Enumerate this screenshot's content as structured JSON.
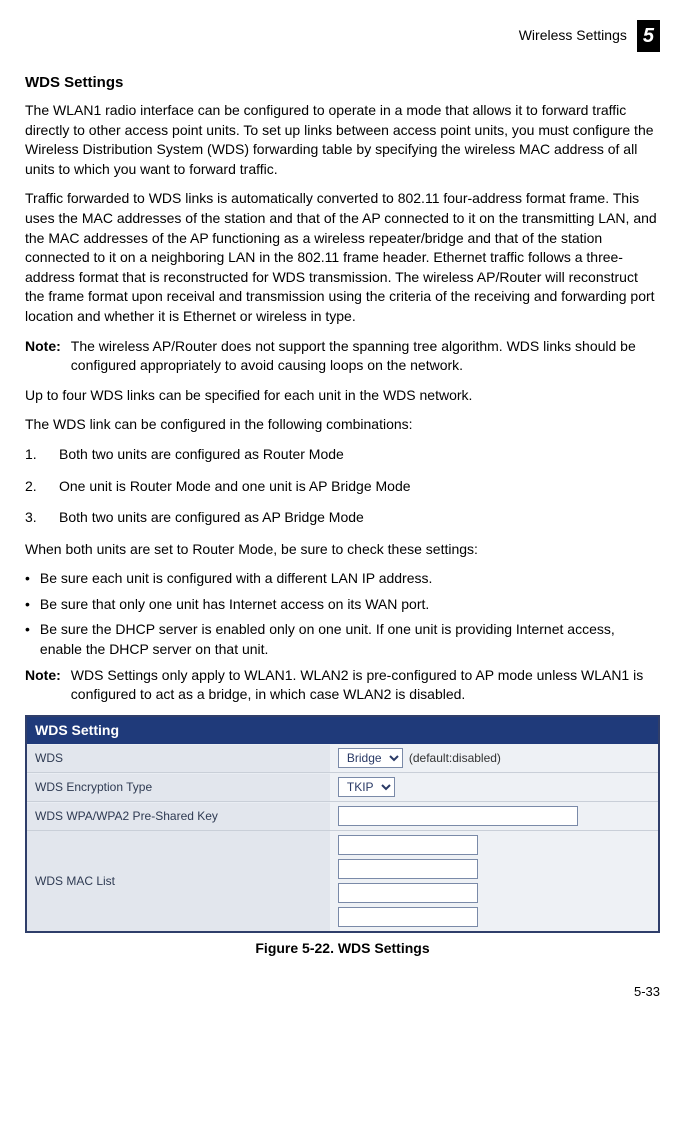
{
  "header": {
    "breadcrumb": "Wireless Settings",
    "chapter_num": "5"
  },
  "section_heading": "WDS Settings",
  "para1": "The WLAN1 radio interface can be configured to operate in a mode that allows it to forward traffic directly to other access point units. To set up links between access point units, you must configure the Wireless Distribution System (WDS) forwarding table by specifying the wireless MAC address of all units to which you want to forward traffic.",
  "para2": "Traffic forwarded to WDS links is automatically converted to 802.11 four-address format frame. This uses the MAC addresses of the station and that of the AP connected to it on the transmitting LAN, and the MAC addresses of the AP functioning as a wireless repeater/bridge and that of the station connected to it on a neighboring LAN in the 802.11 frame header. Ethernet traffic follows a three-address format that is reconstructed for WDS transmission. The wireless AP/Router will reconstruct the frame format upon receival and transmission using the criteria of the receiving and forwarding port location and whether it is Ethernet or wireless in type.",
  "note1_label": "Note:",
  "note1_body": "The wireless AP/Router does not support the spanning tree algorithm. WDS links should be configured appropriately to avoid causing loops on the network.",
  "para3": "Up to four WDS links can be specified for each unit in the WDS network.",
  "para4": "The WDS link can be configured in the following combinations:",
  "ol_items": [
    {
      "n": "1.",
      "t": "Both two units are configured as Router Mode"
    },
    {
      "n": "2.",
      "t": "One unit is Router Mode and one unit is AP Bridge Mode"
    },
    {
      "n": "3.",
      "t": "Both two units are configured as AP Bridge Mode"
    }
  ],
  "para5": "When both units are set to Router Mode, be sure to check these settings:",
  "ul_items": [
    "Be sure each unit is configured with a different LAN IP address.",
    "Be sure that only one unit has Internet access on its WAN port.",
    "Be sure the DHCP server is enabled only on one unit. If one unit is providing Internet access, enable the DHCP server on that unit."
  ],
  "note2_label": "Note:",
  "note2_body": "WDS Settings only apply to WLAN1. WLAN2 is pre-configured to AP mode unless WLAN1 is configured to act as a bridge, in which case WLAN2 is disabled.",
  "wds_panel": {
    "title": "WDS Setting",
    "row_wds_label": "WDS",
    "row_wds_select": "Bridge",
    "row_wds_default": "(default:disabled)",
    "row_enc_label": "WDS Encryption Type",
    "row_enc_select": "TKIP",
    "row_psk_label": "WDS WPA/WPA2 Pre-Shared Key",
    "row_mac_label": "WDS MAC List"
  },
  "figure_caption": "Figure 5-22.   WDS Settings",
  "page_number": "5-33"
}
